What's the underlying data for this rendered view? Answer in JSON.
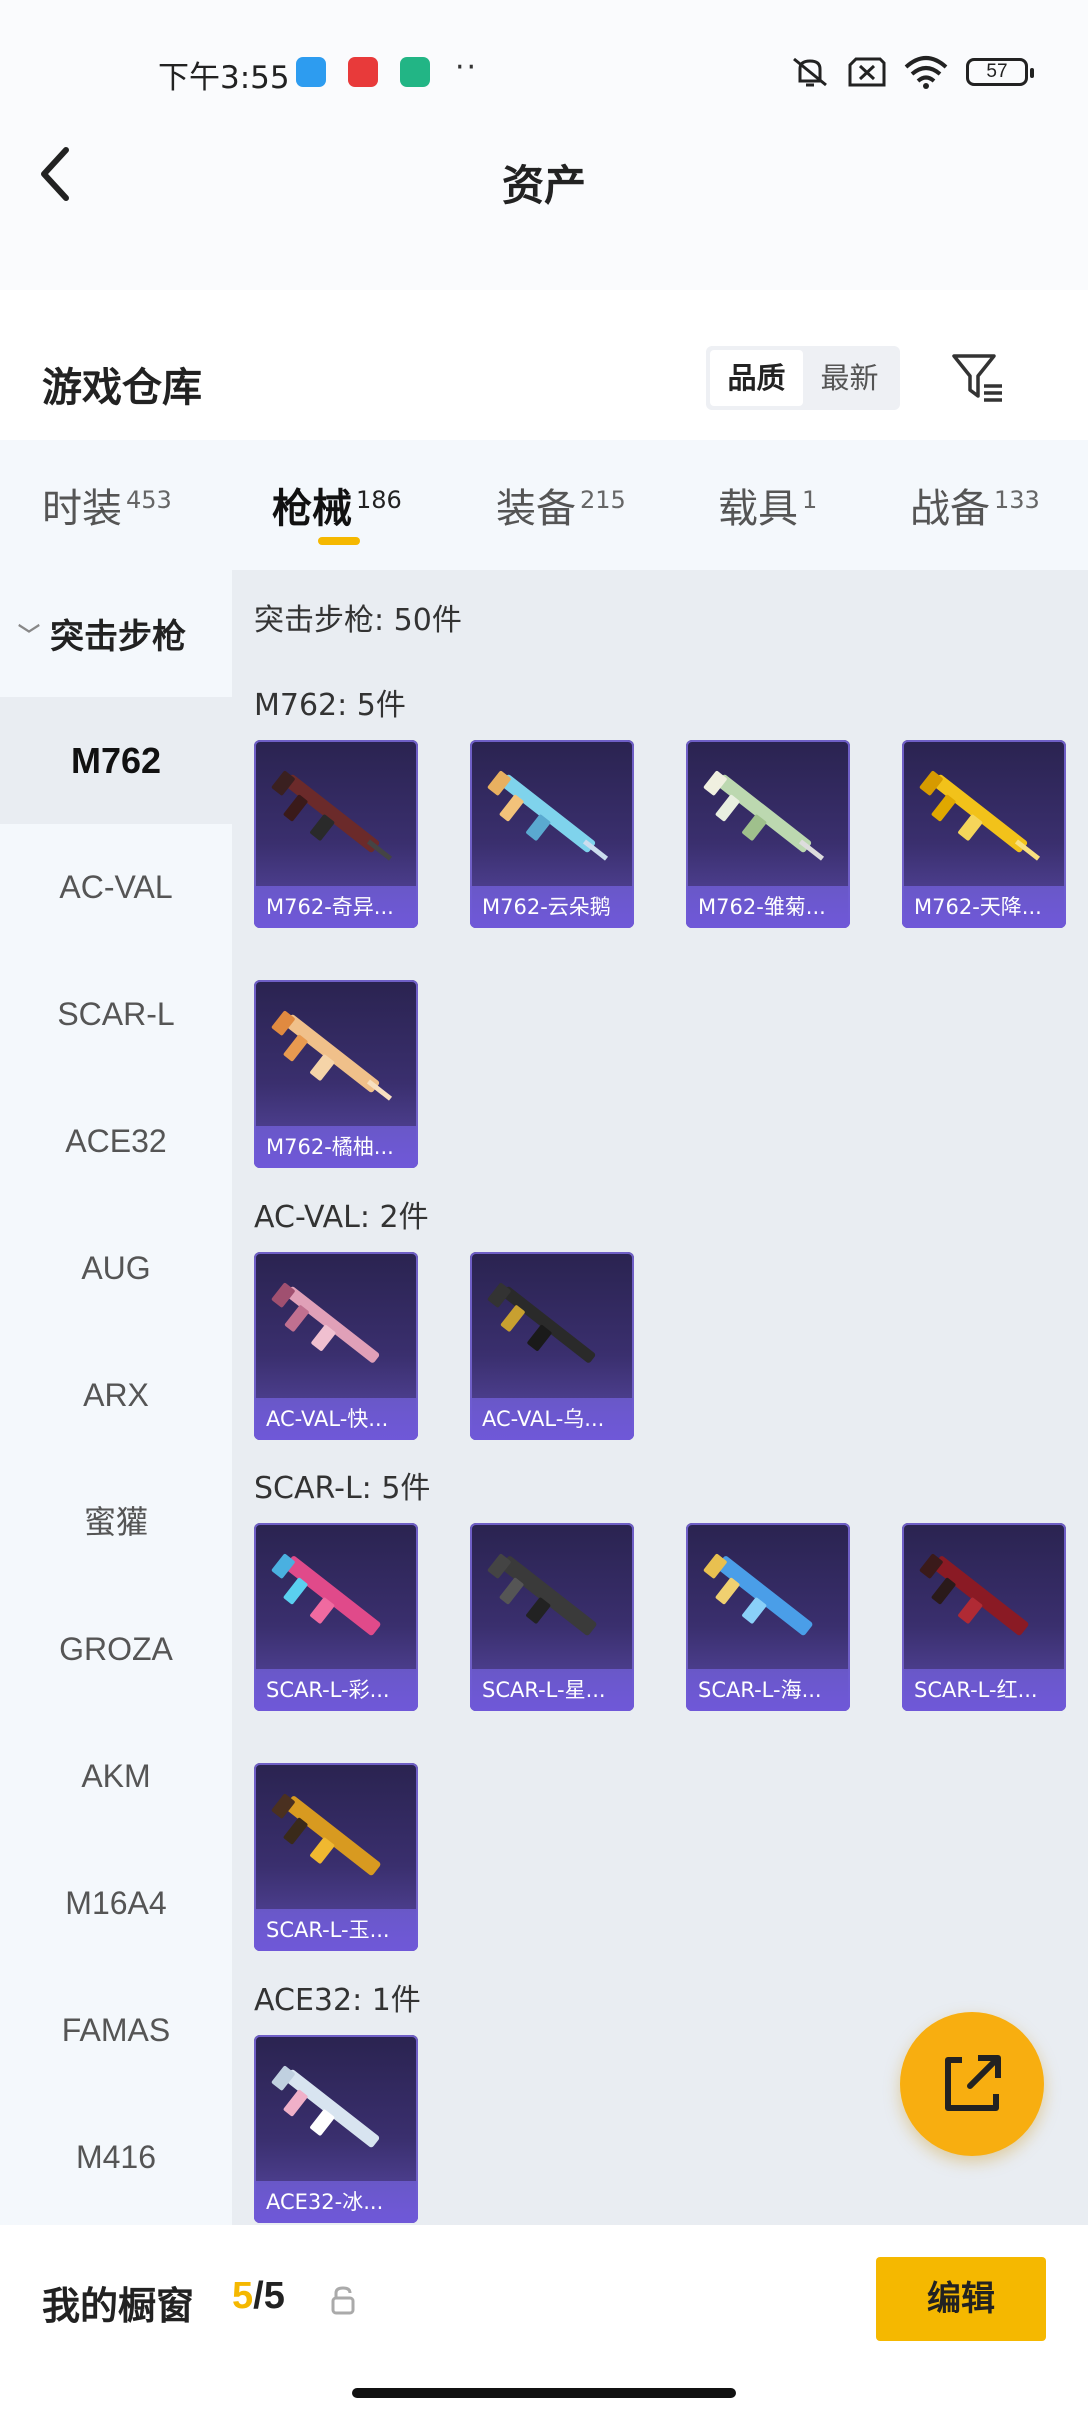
{
  "status_bar": {
    "time": "下午3:55",
    "dots": "··",
    "battery": "57",
    "icons": [
      "app-blue-icon",
      "app-red-icon",
      "app-green-shield-icon",
      "mute-icon",
      "no-sim-icon",
      "wifi-icon",
      "battery-icon"
    ]
  },
  "header": {
    "title": "资产"
  },
  "warehouse": {
    "title": "游戏仓库",
    "sort_options": [
      "品质",
      "最新"
    ],
    "sort_selected": "品质"
  },
  "tabs": [
    {
      "label": "时装",
      "count": "453"
    },
    {
      "label": "枪械",
      "count": "186",
      "active": true
    },
    {
      "label": "装备",
      "count": "215"
    },
    {
      "label": "载具",
      "count": "1"
    },
    {
      "label": "战备",
      "count": "133"
    }
  ],
  "sidebar": {
    "group": "突击步枪",
    "items": [
      "M762",
      "AC-VAL",
      "SCAR-L",
      "ACE32",
      "AUG",
      "ARX",
      "蜜獾",
      "GROZA",
      "AKM",
      "M16A4",
      "FAMAS",
      "M416"
    ],
    "active": "M762"
  },
  "content": {
    "category_title": "突击步枪: 50件",
    "sections": [
      {
        "title": "M762: 5件",
        "items": [
          "M762-奇异...",
          "M762-云朵鹅",
          "M762-雏菊...",
          "M762-天降...",
          "M762-橘柚..."
        ]
      },
      {
        "title": "AC-VAL: 2件",
        "items": [
          "AC-VAL-快...",
          "AC-VAL-乌..."
        ]
      },
      {
        "title": "SCAR-L: 5件",
        "items": [
          "SCAR-L-彩...",
          "SCAR-L-星...",
          "SCAR-L-海...",
          "SCAR-L-红...",
          "SCAR-L-玉..."
        ]
      },
      {
        "title": "ACE32: 1件",
        "items": [
          "ACE32-冰..."
        ]
      }
    ]
  },
  "bottom_bar": {
    "title": "我的橱窗",
    "current": "5",
    "separator": "/",
    "total": "5",
    "edit_label": "编辑"
  },
  "colors": {
    "accent": "#f5b800",
    "fab": "#f8ae10",
    "card_bg": "#3a2f6e",
    "card_label": "#6f58d8"
  }
}
